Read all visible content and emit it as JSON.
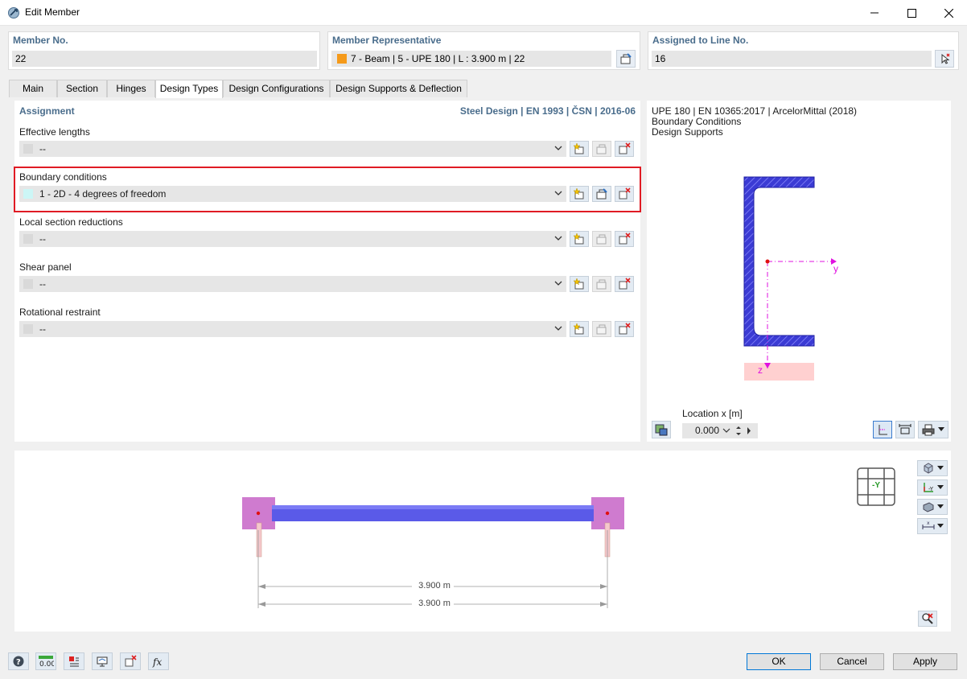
{
  "window": {
    "title": "Edit Member"
  },
  "member_no": {
    "label": "Member No.",
    "value": "22"
  },
  "representative": {
    "label": "Member Representative",
    "value": "7 - Beam | 5 - UPE 180 | L : 3.900 m | 22",
    "swatch_color": "#f59a1a"
  },
  "assigned_line": {
    "label": "Assigned to Line No.",
    "value": "16"
  },
  "tabs": [
    {
      "label": "Main"
    },
    {
      "label": "Section"
    },
    {
      "label": "Hinges"
    },
    {
      "label": "Design Types"
    },
    {
      "label": "Design Configurations"
    },
    {
      "label": "Design Supports & Deflection"
    }
  ],
  "assignment": {
    "title": "Assignment",
    "standard": "Steel Design | EN 1993 | ČSN | 2016-06",
    "rows": [
      {
        "label": "Effective lengths",
        "value": "--",
        "swatch": "#d9d9d9"
      },
      {
        "label": "Boundary conditions",
        "value": "1 - 2D - 4 degrees of freedom",
        "swatch": "#ccf6f6"
      },
      {
        "label": "Local section reductions",
        "value": "--",
        "swatch": "#d9d9d9"
      },
      {
        "label": "Shear panel",
        "value": "--",
        "swatch": "#d9d9d9"
      },
      {
        "label": "Rotational restraint",
        "value": "--",
        "swatch": "#d9d9d9"
      }
    ]
  },
  "preview": {
    "line1": "UPE 180 | EN 10365:2017 | ArcelorMittal (2018)",
    "line2": "Boundary Conditions",
    "line3": "Design Supports",
    "axis_y": "y",
    "axis_z": "z",
    "location_label": "Location x [m]",
    "location_value": "0.000"
  },
  "view3d": {
    "dimension_1": "3.900 m",
    "dimension_2": "3.900 m",
    "view_label": "-Y"
  },
  "buttons": {
    "ok": "OK",
    "cancel": "Cancel",
    "apply": "Apply"
  },
  "colors": {
    "accent_label": "#4a6d8c",
    "highlight_border": "#e01b24",
    "section_fill": "#3b3bd4",
    "support": "#c764c7"
  }
}
